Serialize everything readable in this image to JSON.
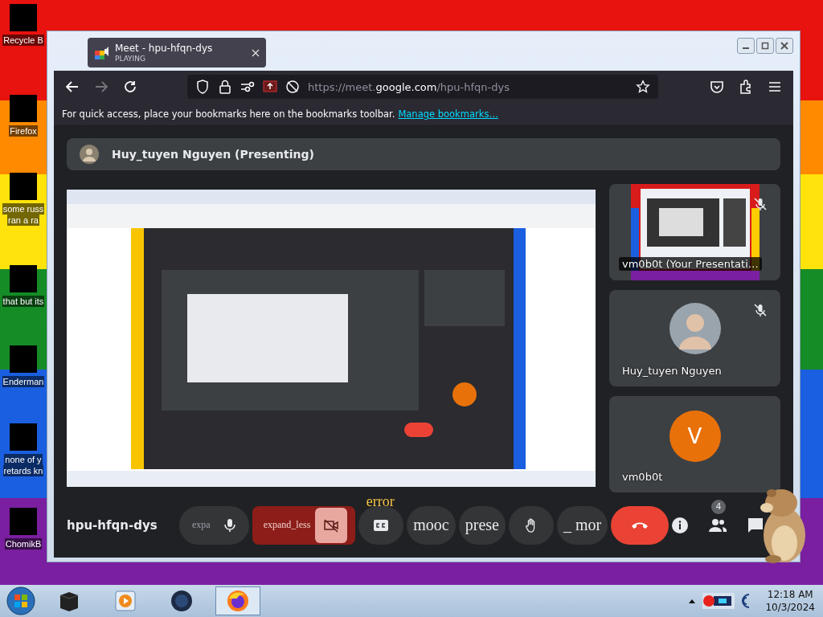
{
  "desktop": {
    "icons": [
      {
        "lines": [
          "Recycle B"
        ]
      },
      {
        "lines": [
          "Firefox"
        ]
      },
      {
        "lines": [
          "some russ",
          "ran a ra"
        ]
      },
      {
        "lines": [
          "that but its"
        ]
      },
      {
        "lines": [
          "Enderman"
        ]
      },
      {
        "lines": [
          "none of y",
          "retards kn"
        ]
      },
      {
        "lines": [
          "ChomikB"
        ]
      }
    ]
  },
  "browser": {
    "tab": {
      "title": "Meet - hpu-hfqn-dys",
      "status": "PLAYING"
    },
    "url": {
      "scheme": "https://meet.",
      "domain": "google.com",
      "path": "/hpu-hfqn-dys"
    },
    "bookmarks_bar": {
      "text": "For quick access, place your bookmarks here on the bookmarks toolbar.",
      "link": "Manage bookmarks…"
    }
  },
  "meet": {
    "presenter": "Huy_tuyen Nguyen (Presenting)",
    "tiles": [
      {
        "kind": "screen",
        "name": "vm0b0t (Your Presentati…",
        "muted": true
      },
      {
        "name": "Huy_tuyen Nguyen",
        "muted": true
      },
      {
        "kind": "letter",
        "letter": "V",
        "name": "vm0b0t",
        "muted": false
      }
    ],
    "meeting_code": "hpu-hfqn-dys",
    "controls": [
      {
        "kind": "mic",
        "text": "expa"
      },
      {
        "kind": "camera",
        "text": "expand_less",
        "overlay": "error"
      },
      {
        "kind": "captions"
      },
      {
        "kind": "text",
        "text": "mooc"
      },
      {
        "kind": "text",
        "text": "prese"
      },
      {
        "kind": "hand"
      },
      {
        "kind": "text",
        "text": "_ mor"
      },
      {
        "kind": "hangup"
      }
    ],
    "people_count": "4"
  },
  "taskbar": {
    "time": "12:18 AM",
    "date": "10/3/2024"
  }
}
